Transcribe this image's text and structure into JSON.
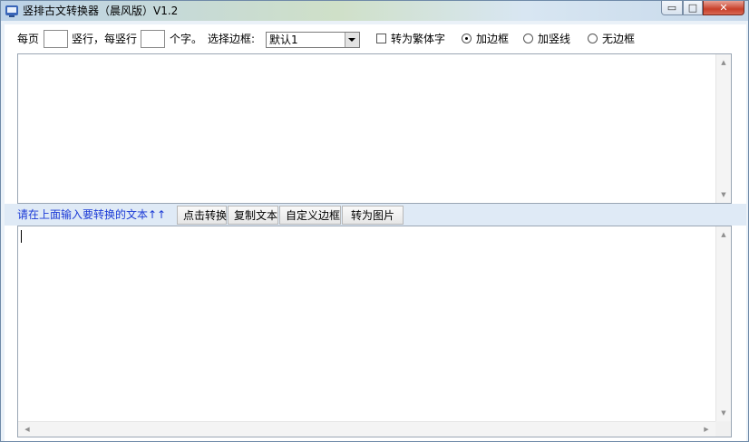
{
  "window": {
    "title": "竖排古文转换器（晨风版）V1.2"
  },
  "caption_buttons": {
    "minimize": "▭",
    "maximize": "□",
    "close": "✕"
  },
  "options": {
    "per_page_label": "每页",
    "columns_label": "竖行，每竖行",
    "chars_label": "个字。",
    "border_select_label": "选择边框:",
    "border_selected": "默认1",
    "traditional_label": "转为繁体字",
    "traditional_checked": false,
    "radio_add_border": "加边框",
    "radio_add_lines": "加竖线",
    "radio_no_border": "无边框",
    "radio_selected": "加边框"
  },
  "toolbar": {
    "hint": "请在上面输入要转换的文本↑↑",
    "convert": "点击转换",
    "copy": "复制文本",
    "custom_border": "自定义边框",
    "to_image": "转为图片"
  },
  "scroll_glyphs": {
    "up": "▲",
    "down": "▼",
    "left": "◀",
    "right": "▶"
  },
  "colors": {
    "hint_text": "#1b3ad6",
    "toolbar_bg": "#dfeaf6"
  }
}
